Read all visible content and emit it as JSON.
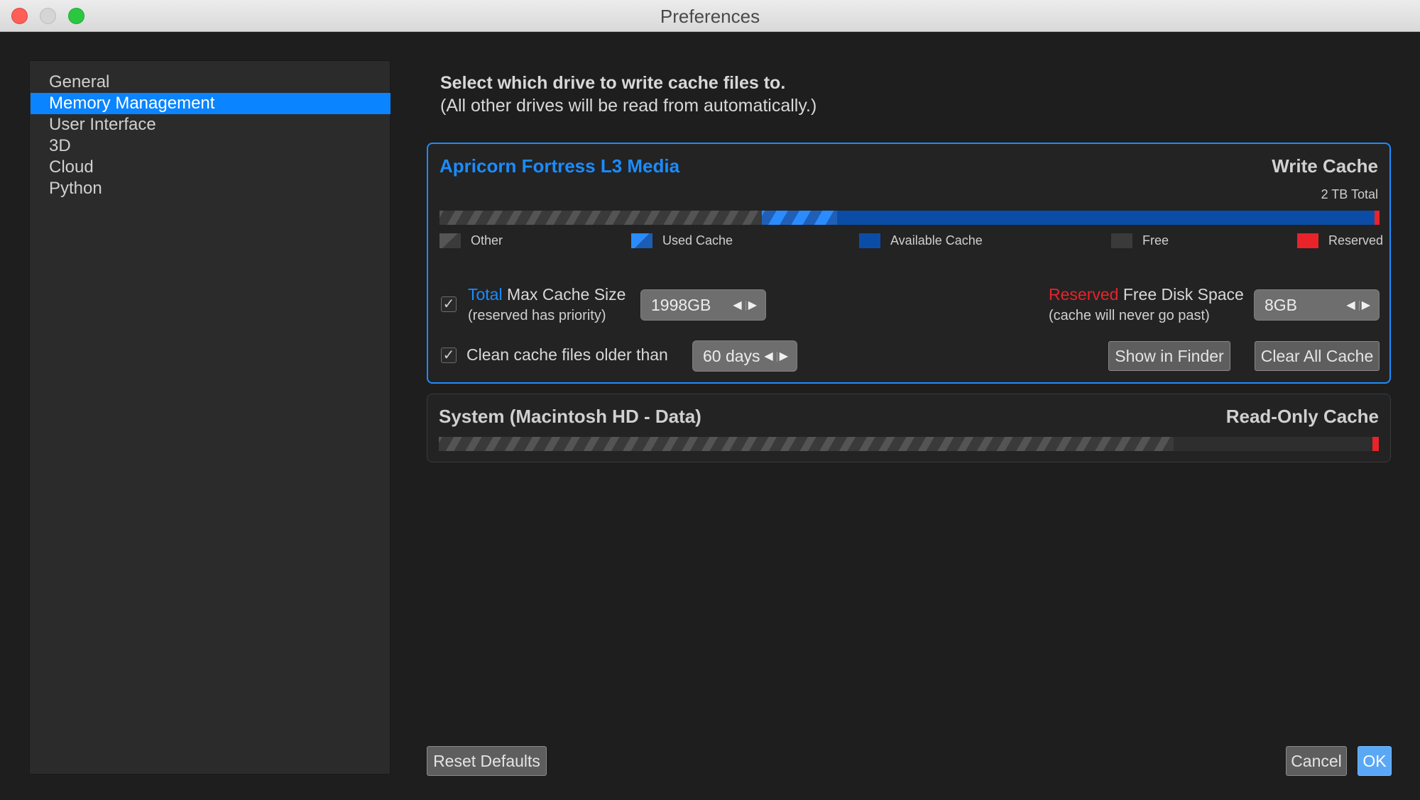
{
  "window": {
    "title": "Preferences"
  },
  "sidebar": {
    "items": [
      {
        "label": "General"
      },
      {
        "label": "Memory Management",
        "selected": true
      },
      {
        "label": "User Interface"
      },
      {
        "label": "3D"
      },
      {
        "label": "Cloud"
      },
      {
        "label": "Python"
      }
    ]
  },
  "intro": {
    "line1": "Select which drive to write cache files to.",
    "line2": "(All other drives will be read from automatically.)"
  },
  "write_drive": {
    "name": "Apricorn Fortress L3 Media",
    "cache_type": "Write Cache",
    "total": "2 TB Total",
    "usage_fractions": {
      "other": 0.343,
      "used_cache": 0.08,
      "available_cache": 0.572,
      "reserved": 0.005
    },
    "legend": {
      "other": "Other",
      "used_cache": "Used Cache",
      "available_cache": "Available Cache",
      "free": "Free",
      "reserved": "Reserved"
    },
    "max_cache": {
      "checked": true,
      "label_highlight": "Total",
      "label_rest": " Max Cache Size",
      "sub": "(reserved has priority)",
      "value": "1998GB"
    },
    "reserved_space": {
      "label_highlight": "Reserved",
      "label_rest": " Free Disk Space",
      "sub": "(cache will never go past)",
      "value": "8GB"
    },
    "clean_cache": {
      "checked": true,
      "label": "Clean cache files older than",
      "value": "60 days"
    },
    "show_in_finder": "Show in Finder",
    "clear_all_cache": "Clear All Cache"
  },
  "read_drive": {
    "name": "System (Macintosh HD - Data)",
    "cache_type": "Read-Only Cache",
    "usage_fractions": {
      "other": 0.782,
      "free": 0.211,
      "reserved": 0.007
    }
  },
  "footer": {
    "reset": "Reset Defaults",
    "cancel": "Cancel",
    "ok": "OK"
  },
  "colors": {
    "accent": "#0a84ff",
    "drive_name": "#1a8cff",
    "reserved": "#e8232a",
    "available_cache": "#0b4da6"
  },
  "icons": {
    "checkbox_mark": "✓",
    "stepper_left": "◀",
    "stepper_right": "▶"
  }
}
